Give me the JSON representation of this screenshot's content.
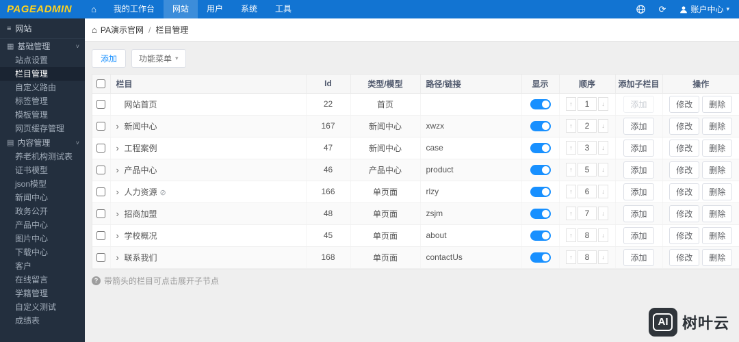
{
  "topbar": {
    "logo": "PAGEADMIN",
    "nav": [
      {
        "label": "我的工作台",
        "active": false
      },
      {
        "label": "网站",
        "active": true
      },
      {
        "label": "用户",
        "active": false
      },
      {
        "label": "系统",
        "active": false
      },
      {
        "label": "工具",
        "active": false
      }
    ],
    "account_label": "账户中心"
  },
  "sidebar": {
    "title": "网站",
    "sections": [
      {
        "label": "基础管理",
        "items": [
          {
            "label": "站点设置",
            "active": false
          },
          {
            "label": "栏目管理",
            "active": true
          },
          {
            "label": "自定义路由",
            "active": false
          },
          {
            "label": "标签管理",
            "active": false
          },
          {
            "label": "模板管理",
            "active": false
          },
          {
            "label": "网页缓存管理",
            "active": false
          }
        ]
      },
      {
        "label": "内容管理",
        "items": [
          {
            "label": "养老机构测试表",
            "active": false
          },
          {
            "label": "证书模型",
            "active": false
          },
          {
            "label": "json模型",
            "active": false
          },
          {
            "label": "新闻中心",
            "active": false
          },
          {
            "label": "政务公开",
            "active": false
          },
          {
            "label": "产品中心",
            "active": false
          },
          {
            "label": "图片中心",
            "active": false
          },
          {
            "label": "下载中心",
            "active": false
          },
          {
            "label": "客户",
            "active": false
          },
          {
            "label": "在线留言",
            "active": false
          },
          {
            "label": "学籍管理",
            "active": false
          },
          {
            "label": "自定义测试",
            "active": false
          },
          {
            "label": "成绩表",
            "active": false
          }
        ]
      }
    ]
  },
  "breadcrumb": {
    "site": "PA演示官网",
    "separator": "/",
    "page": "栏目管理"
  },
  "toolbar": {
    "add_label": "添加",
    "menu_label": "功能菜单"
  },
  "table": {
    "headers": {
      "column": "栏目",
      "id": "Id",
      "type": "类型/模型",
      "path": "路径/链接",
      "visible": "显示",
      "order": "顺序",
      "add_child": "添加子栏目",
      "actions": "操作"
    },
    "action_labels": {
      "add": "添加",
      "edit": "修改",
      "delete": "删除"
    },
    "rows": [
      {
        "name": "网站首页",
        "id": "22",
        "type": "首页",
        "path": "",
        "visible": true,
        "order": "1",
        "expandable": false,
        "add_enabled": false,
        "badge": false
      },
      {
        "name": "新闻中心",
        "id": "167",
        "type": "新闻中心",
        "path": "xwzx",
        "visible": true,
        "order": "2",
        "expandable": true,
        "add_enabled": true,
        "badge": false
      },
      {
        "name": "工程案例",
        "id": "47",
        "type": "新闻中心",
        "path": "case",
        "visible": true,
        "order": "3",
        "expandable": true,
        "add_enabled": true,
        "badge": false
      },
      {
        "name": "产品中心",
        "id": "46",
        "type": "产品中心",
        "path": "product",
        "visible": true,
        "order": "5",
        "expandable": true,
        "add_enabled": true,
        "badge": false
      },
      {
        "name": "人力资源",
        "id": "166",
        "type": "单页面",
        "path": "rlzy",
        "visible": true,
        "order": "6",
        "expandable": true,
        "add_enabled": true,
        "badge": true
      },
      {
        "name": "招商加盟",
        "id": "48",
        "type": "单页面",
        "path": "zsjm",
        "visible": true,
        "order": "7",
        "expandable": true,
        "add_enabled": true,
        "badge": false
      },
      {
        "name": "学校概况",
        "id": "45",
        "type": "单页面",
        "path": "about",
        "visible": true,
        "order": "8",
        "expandable": true,
        "add_enabled": true,
        "badge": false
      },
      {
        "name": "联系我们",
        "id": "168",
        "type": "单页面",
        "path": "contactUs",
        "visible": true,
        "order": "8",
        "expandable": true,
        "add_enabled": true,
        "badge": false
      }
    ]
  },
  "footnote": "带箭头的栏目可点击展开子节点",
  "watermark": {
    "logo": "AI",
    "text": "树叶云"
  },
  "colors": {
    "topbar": "#1274d2",
    "accent": "#1890ff",
    "sidebar": "#232f3e",
    "logo_yellow": "#ffd21e"
  }
}
